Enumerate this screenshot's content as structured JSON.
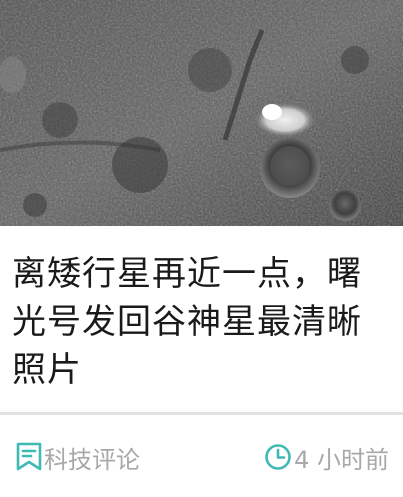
{
  "article": {
    "title": "离矮行星再近一点，曙光号发回谷神星最清晰照片",
    "image_alt": "谷神星表面",
    "source": "科技评论",
    "time": "4 小时前"
  },
  "colors": {
    "accent": "#3fb9b4",
    "meta_text": "#a8a8a8",
    "title_text": "#1a1a1a"
  },
  "icons": {
    "source": "bookmark-icon",
    "time": "clock-icon"
  }
}
